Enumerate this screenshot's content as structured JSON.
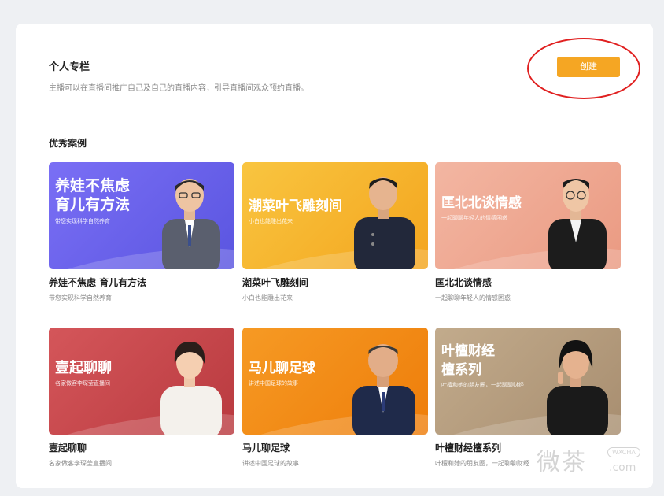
{
  "personal_column": {
    "title": "个人专栏",
    "description": "主播可以在直播间推广自己及自己的直播内容，引导直播间观众预约直播。",
    "create_label": "创建"
  },
  "cases": {
    "title": "优秀案例",
    "items": [
      {
        "banner_title": "养娃不焦虑\n育儿有方法",
        "banner_sub": "带您实现科学自然养育",
        "title": "养娃不焦虑 育儿有方法",
        "desc": "带您实现科学自然养育",
        "color": "#6b64f0"
      },
      {
        "banner_title": "潮菜叶飞雕刻间",
        "banner_sub": "小白也能雕出花来",
        "title": "潮菜叶飞雕刻间",
        "desc": "小白也能雕出花来",
        "color": "#f7b52c"
      },
      {
        "banner_title": "匡北北谈情感",
        "banner_sub": "一起聊聊年轻人的情感困惑",
        "title": "匡北北谈情感",
        "desc": "一起聊聊年轻人的情感困惑",
        "color": "#eea48d"
      },
      {
        "banner_title": "壹起聊聊",
        "banner_sub": "名家做客李琛莹直播间",
        "title": "壹起聊聊",
        "desc": "名家做客李琛莹直播间",
        "color": "#c9474b"
      },
      {
        "banner_title": "马儿聊足球",
        "banner_sub": "讲述中国足球的故事",
        "title": "马儿聊足球",
        "desc": "讲述中国足球的故事",
        "color": "#f28a14"
      },
      {
        "banner_title": "叶檀财经\n檀系列",
        "banner_sub": "叶檀和她的朋友圈，一起聊聊财经",
        "title": "叶檀财经檀系列",
        "desc": "叶檀和她的朋友圈，一起聊聊财经",
        "color": "#b59d7e"
      }
    ]
  },
  "watermark": {
    "big": "微茶",
    "tag": "WXCHA",
    "com": ".com"
  }
}
